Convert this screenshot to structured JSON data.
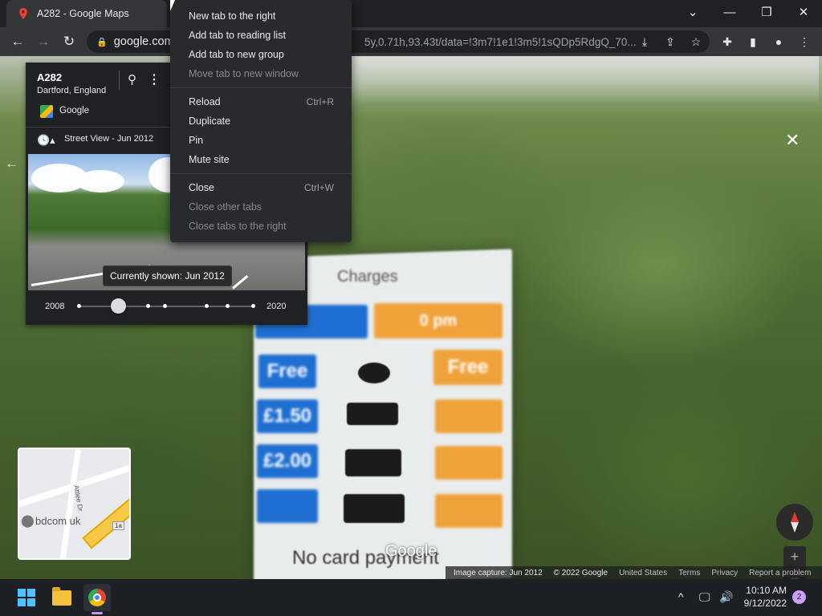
{
  "browser": {
    "tab_title": "A282 - Google Maps",
    "url_host": "google.com",
    "url_rest": "5y,0.71h,93.43t/data=!3m7!1e1!3m5!1sQDp5RdgQ_70...",
    "window_controls": [
      "chevron-down-icon",
      "minimize-icon",
      "restore-icon",
      "close-icon"
    ]
  },
  "context_menu": {
    "groups": [
      [
        {
          "label": "New tab to the right",
          "shortcut": "",
          "disabled": false
        },
        {
          "label": "Add tab to reading list",
          "shortcut": "",
          "disabled": false
        },
        {
          "label": "Add tab to new group",
          "shortcut": "",
          "disabled": false
        },
        {
          "label": "Move tab to new window",
          "shortcut": "",
          "disabled": true
        }
      ],
      [
        {
          "label": "Reload",
          "shortcut": "Ctrl+R",
          "disabled": false
        },
        {
          "label": "Duplicate",
          "shortcut": "",
          "disabled": false
        },
        {
          "label": "Pin",
          "shortcut": "",
          "disabled": false
        },
        {
          "label": "Mute site",
          "shortcut": "",
          "disabled": false
        }
      ],
      [
        {
          "label": "Close",
          "shortcut": "Ctrl+W",
          "disabled": false
        },
        {
          "label": "Close other tabs",
          "shortcut": "",
          "disabled": true
        },
        {
          "label": "Close tabs to the right",
          "shortcut": "",
          "disabled": true
        }
      ]
    ]
  },
  "panel": {
    "title": "A282",
    "subtitle": "Dartford, England",
    "provider": "Google",
    "street_view_label": "Street View - Jun 2012",
    "tooltip": "Currently shown: Jun 2012",
    "timeline_start": "2008",
    "timeline_end": "2020",
    "timeline_current_index": 1,
    "timeline_count": 8
  },
  "sign": {
    "title": "Charges",
    "chips": [
      "Free",
      "£1.50",
      "£2.00",
      "Free",
      "0 pm"
    ],
    "footer": "No card payment"
  },
  "minimap": {
    "street": "Attlee Dr",
    "place": "bdcom uk",
    "road_badge": "1a"
  },
  "map_footer": {
    "google_logo": "Google",
    "capture": "Image capture: Jun 2012",
    "copyright": "© 2022 Google",
    "links": [
      "United States",
      "Terms",
      "Privacy",
      "Report a problem"
    ]
  },
  "taskbar": {
    "time": "10:10 AM",
    "date": "9/12/2022",
    "notifications": "2"
  },
  "colors": {
    "accent": "#c399f0",
    "menu_bg": "#292a2d",
    "chrome_dark": "#202124"
  }
}
